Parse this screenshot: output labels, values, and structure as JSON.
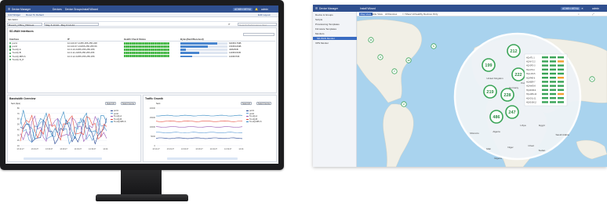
{
  "dashboard": {
    "topbar": {
      "menu_title": "Device Manager",
      "menu_tabs": [
        "Devices",
        "Device Groups",
        "Install Wizard"
      ],
      "badge": "ADMIN MENU",
      "user": "admin"
    },
    "toolbar": {
      "add_widget": "Add Widget",
      "reset": "Reset To Default",
      "right": "Edit Layout"
    },
    "breadcrumb": "SD-WAN",
    "filter": {
      "device": "Branch_Office_Hillcrest",
      "date_range": "May 6 13:24 - May 6 14:24",
      "search_placeholder": "Search Performance Stat"
    },
    "wan_panel": {
      "title": "SD-WAN Interfaces",
      "columns": [
        "Interface",
        "IP",
        "Health Check Status",
        "Bytes(Sent/Received)"
      ],
      "rows": [
        {
          "name": "port1",
          "ip": "10.100.67.1/255.255.255.248",
          "rate": 0.78,
          "bytes": "64KB/17MB"
        },
        {
          "name": "port2",
          "ip": "10.100.67.13/255.255.255.56",
          "rate": 0.58,
          "bytes": "15KB/10MB"
        },
        {
          "name": "To-HQ-A",
          "ip": "10.0.10.2/255.255.255.255",
          "rate": 0.12,
          "bytes": "4KB/8KB"
        },
        {
          "name": "To-HQ-B",
          "ip": "10.0.11.2/255.255.255.255",
          "rate": 0.4,
          "bytes": "12KB/15KB"
        },
        {
          "name": "To-HQ-MPLS",
          "ip": "10.0.12.2/255.255.255.255",
          "rate": 0.25,
          "bytes": "10KB/7KB"
        },
        {
          "name": "To-HQ-N_8",
          "ip": "",
          "rate": 0,
          "bytes": ""
        }
      ]
    },
    "bandwidth": {
      "title": "Bandwidth Overview",
      "buttons": [
        "Select All",
        "Select Inverse"
      ],
      "ylabel": "Sent (bps)",
      "legend": [
        "port1",
        "port2",
        "To-HQ-A",
        "To-HQ-B",
        "To-HQ-MPLS"
      ],
      "yticks": [
        "8K",
        "7K",
        "6K",
        "5K",
        "4K",
        "3K",
        "2K",
        "1K"
      ],
      "xticks": [
        "13:14:27",
        "13:19:27",
        "13:34:27",
        "13:49:27",
        "14:04:27",
        "14:19:27",
        "14:24:27"
      ]
    },
    "growth": {
      "title": "Traffic Growth",
      "buttons": [
        "Select All",
        "Select Inverse"
      ],
      "ylabel": "Sent",
      "legend": [
        "port1",
        "port2",
        "To-HQ-A",
        "To-HQ-B",
        "To-HQ-MPLS"
      ],
      "yticks": [
        "20000",
        "15000",
        "10000",
        "5000",
        "0"
      ],
      "xticks": [
        "13:14:27",
        "13:19:27",
        "13:34:27",
        "13:49:27",
        "14:04:27",
        "14:19:27",
        "14:24:27"
      ]
    }
  },
  "map": {
    "topbar": {
      "menu_title": "Device Manager",
      "wizard": "Install Wizard",
      "badge": "ADMIN MENU",
      "user": "admin"
    },
    "sidebar": [
      "Device & Groups",
      "Scripts",
      "Provisioning Templates",
      "Firmware Templates",
      "Monitors",
      "SD-WAN Monitor",
      "VPN Monitor"
    ],
    "toolbar": {
      "map_view": "Map View",
      "table_view": "Table View",
      "filter": "All Devices",
      "checkbox": "Show Unhealthy Devices Only"
    },
    "clusters": [
      {
        "label": "11"
      },
      {
        "label": "3"
      },
      {
        "label": "7"
      },
      {
        "label": "12"
      },
      {
        "label": "199"
      },
      {
        "label": "212"
      },
      {
        "label": "222"
      },
      {
        "label": "219"
      },
      {
        "label": "228"
      },
      {
        "label": "486"
      },
      {
        "label": "247"
      },
      {
        "label": "5"
      },
      {
        "label": "2"
      },
      {
        "label": "4"
      },
      {
        "label": "1"
      }
    ],
    "places": [
      "Morocco",
      "Algeria",
      "Libya",
      "Egypt",
      "Mali",
      "Niger",
      "Chad",
      "Sudan",
      "Saudi Arabia",
      "Nigeria",
      "Poland",
      "Germany",
      "United Kingdom"
    ],
    "popup_rows": [
      "HQ-ATL-1",
      "HQ-NYC-2",
      "HQ-SFO-3",
      "HQ-CHI-4",
      "HQ-LON-5",
      "HQ-PAR-6",
      "HQ-BER-7",
      "HQ-MAD-8",
      "HQ-ROM-9",
      "HQ-AMS-10",
      "HQ-OSL-11",
      "HQ-DUB-12"
    ]
  },
  "colors": {
    "brand": "#2f4f8f",
    "accent": "#3a6cc2",
    "ok": "#38b03a",
    "cluster": "#3aa457",
    "sea": "#a9d3ee",
    "land": "#f1efe6"
  }
}
